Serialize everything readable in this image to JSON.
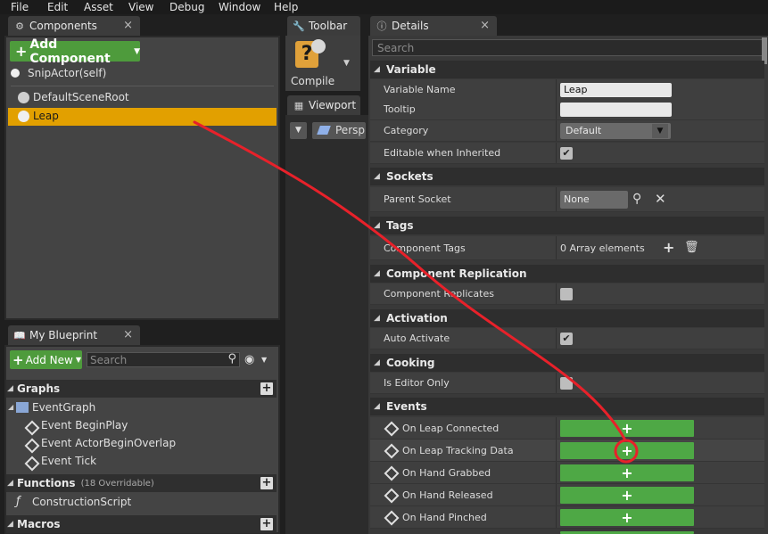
{
  "menu": [
    "File",
    "Edit",
    "Asset",
    "View",
    "Debug",
    "Window",
    "Help"
  ],
  "tabs": {
    "components": "Components",
    "toolbar": "Toolbar",
    "details": "Details",
    "viewport": "Viewport",
    "my_blueprint": "My Blueprint"
  },
  "components_panel": {
    "add_component_label": "Add Component",
    "self_item": "SnipActor(self)",
    "items": [
      "DefaultSceneRoot",
      "Leap"
    ],
    "selected": "Leap"
  },
  "toolbar": {
    "compile_label": "Compile",
    "perspective_label": "Persp"
  },
  "details": {
    "search_placeholder": "Search",
    "sections": {
      "variable": "Variable",
      "sockets": "Sockets",
      "tags": "Tags",
      "component_replication": "Component Replication",
      "activation": "Activation",
      "cooking": "Cooking",
      "events": "Events"
    },
    "variable_name_label": "Variable Name",
    "variable_name_value": "Leap",
    "tooltip_label": "Tooltip",
    "tooltip_value": "",
    "category_label": "Category",
    "category_value": "Default",
    "editable_label": "Editable when Inherited",
    "parent_socket_label": "Parent Socket",
    "parent_socket_value": "None",
    "component_tags_label": "Component Tags",
    "component_tags_value": "0 Array elements",
    "component_replicates_label": "Component Replicates",
    "auto_activate_label": "Auto Activate",
    "is_editor_only_label": "Is Editor Only",
    "events": [
      "On Leap Connected",
      "On Leap Tracking Data",
      "On Hand Grabbed",
      "On Hand Released",
      "On Hand Pinched"
    ]
  },
  "my_blueprint": {
    "add_new_label": "Add New",
    "search_placeholder": "Search",
    "graphs_label": "Graphs",
    "event_graph_label": "EventGraph",
    "graph_events": [
      "Event BeginPlay",
      "Event ActorBeginOverlap",
      "Event Tick"
    ],
    "functions_label": "Functions",
    "functions_count": "(18 Overridable)",
    "construction_script": "ConstructionScript",
    "macros_label": "Macros"
  },
  "colors": {
    "accent_green": "#4ea845",
    "selection_orange": "#e2a000",
    "annotation_red": "#e8212a"
  }
}
